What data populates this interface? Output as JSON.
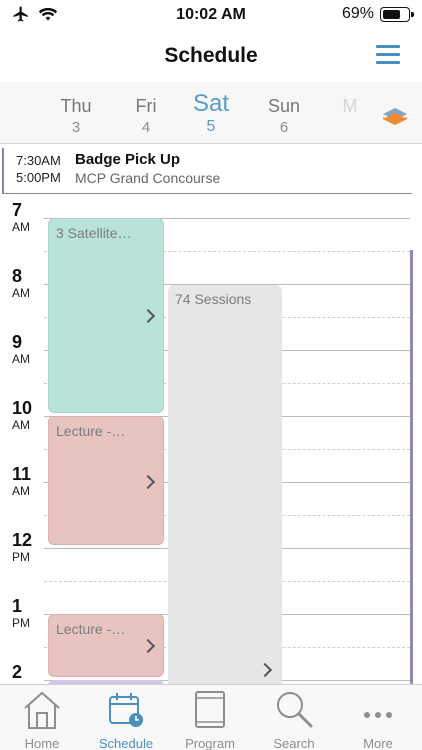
{
  "status_bar": {
    "time": "10:02 AM",
    "battery": "69%",
    "battery_level": 0.69
  },
  "header": {
    "title": "Schedule"
  },
  "days": [
    {
      "name": "Thu",
      "num": "3"
    },
    {
      "name": "Fri",
      "num": "4"
    },
    {
      "name": "Sat",
      "num": "5"
    },
    {
      "name": "Sun",
      "num": "6"
    },
    {
      "name": "M",
      "num": ""
    }
  ],
  "all_day_event": {
    "start": "7:30AM",
    "end": "5:00PM",
    "title": "Badge Pick Up",
    "location": "MCP Grand Concourse"
  },
  "hours": [
    {
      "num": "7",
      "ampm": "AM"
    },
    {
      "num": "8",
      "ampm": "AM"
    },
    {
      "num": "9",
      "ampm": "AM"
    },
    {
      "num": "10",
      "ampm": "AM"
    },
    {
      "num": "11",
      "ampm": "AM"
    },
    {
      "num": "12",
      "ampm": "PM"
    },
    {
      "num": "1",
      "ampm": "PM"
    },
    {
      "num": "2",
      "ampm": ""
    }
  ],
  "blocks": [
    {
      "label": "3 Satellite…",
      "color": "#b9e3d8"
    },
    {
      "label": "Lecture -…",
      "color": "#e8c4c1"
    },
    {
      "label": "Lecture -…",
      "color": "#e8c4c1"
    },
    {
      "label": "74 Sessions",
      "color": "#e6e6e6"
    }
  ],
  "tabs": [
    {
      "label": "Home",
      "icon": "home-icon"
    },
    {
      "label": "Schedule",
      "icon": "calendar-clock-icon"
    },
    {
      "label": "Program",
      "icon": "book-icon"
    },
    {
      "label": "Search",
      "icon": "search-icon"
    },
    {
      "label": "More",
      "icon": "more-dots-icon"
    }
  ],
  "colors": {
    "accent": "#4a8fbd",
    "timeline_bar": "#9189b6",
    "layers_orange": "#ee8a2f"
  }
}
